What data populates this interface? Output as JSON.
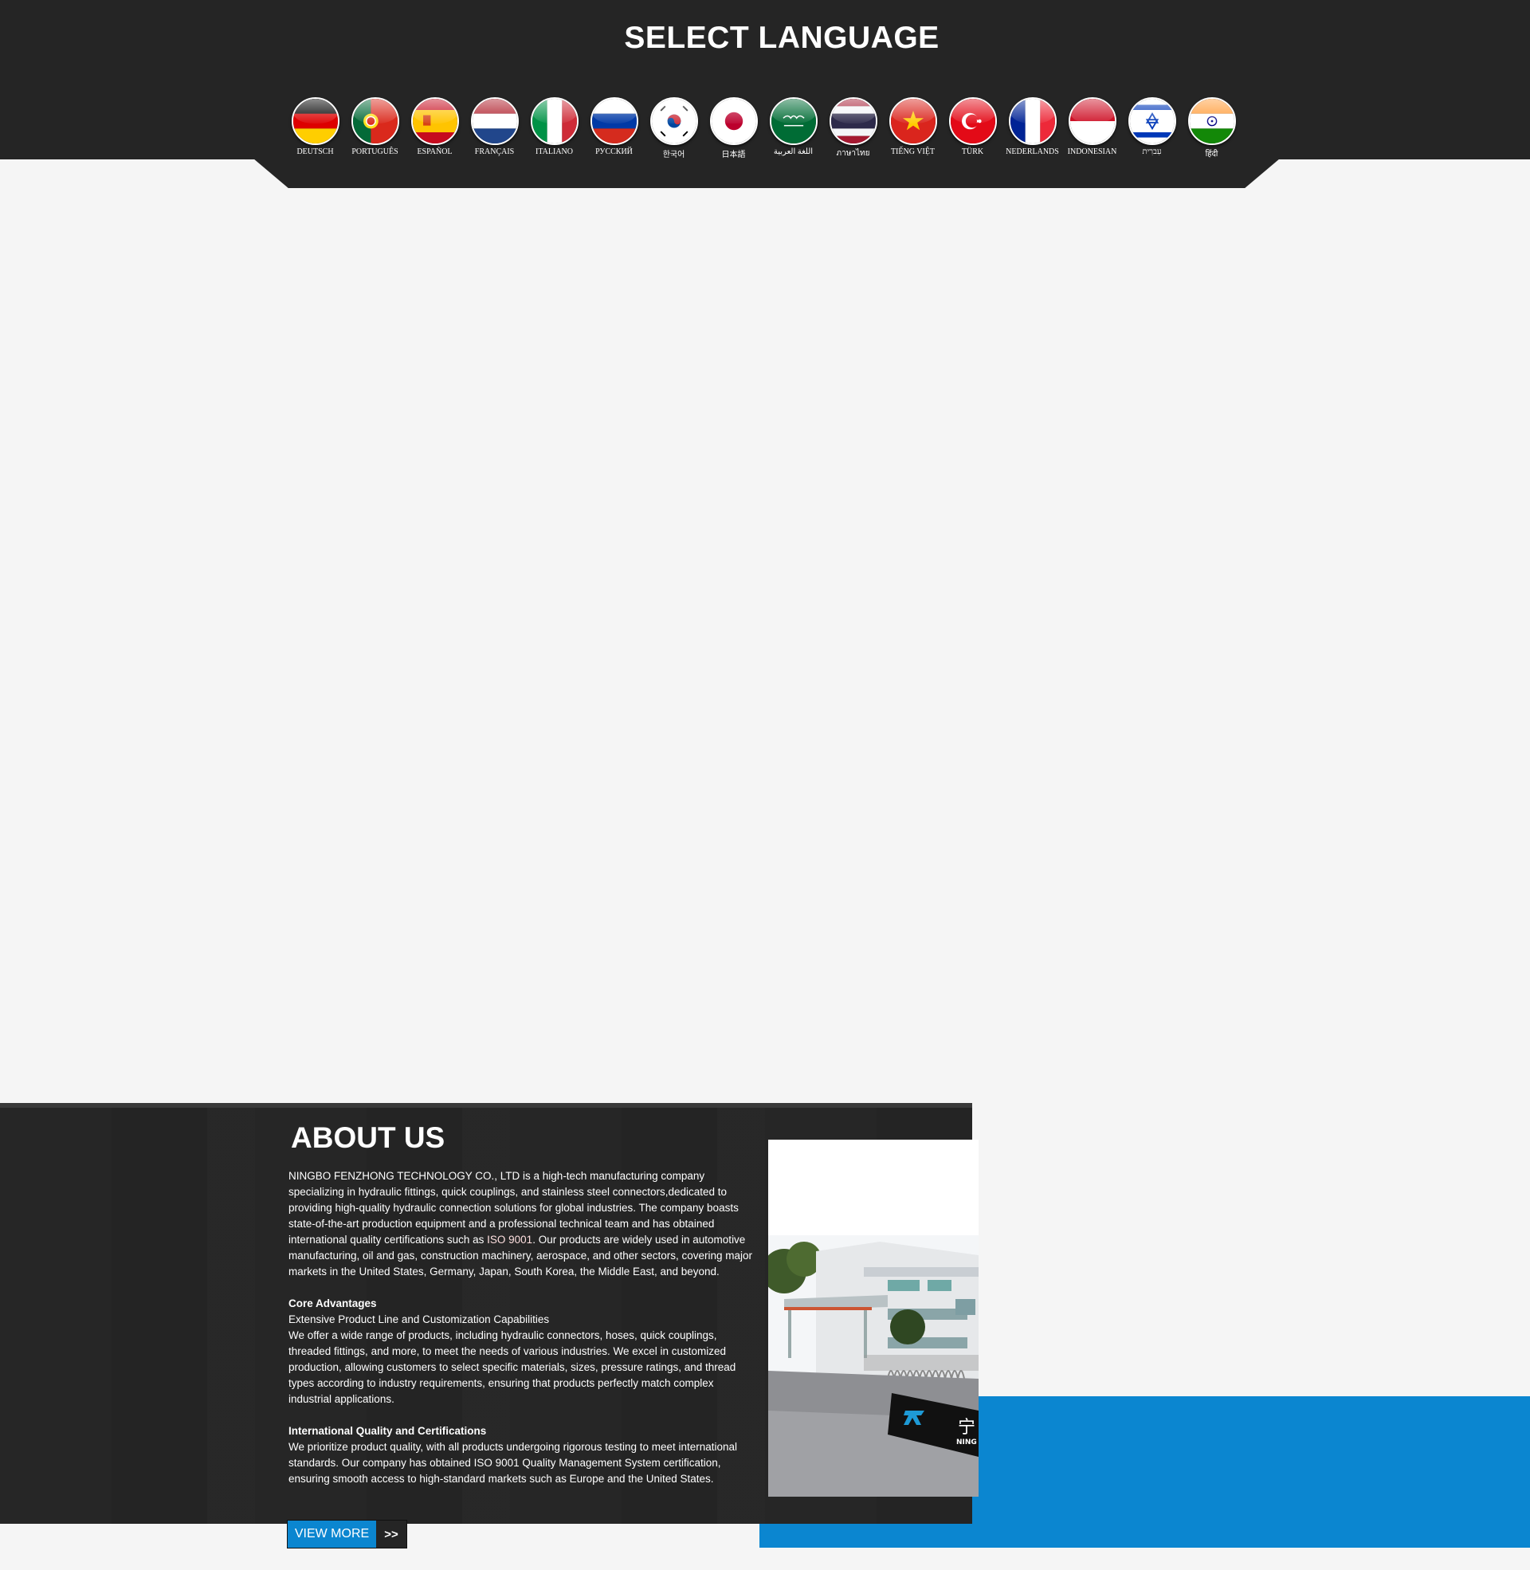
{
  "language_bar": {
    "title": "SELECT LANGUAGE",
    "languages": [
      {
        "label": "DEUTSCH",
        "flag": "germany-flag-icon"
      },
      {
        "label": "PORTUGUÊS",
        "flag": "portugal-flag-icon"
      },
      {
        "label": "ESPAÑOL",
        "flag": "spain-flag-icon"
      },
      {
        "label": "FRANÇAIS",
        "flag": "netherlands-flag-icon"
      },
      {
        "label": "ITALIANO",
        "flag": "italy-flag-icon"
      },
      {
        "label": "РУССКИЙ",
        "flag": "russia-flag-icon"
      },
      {
        "label": "한국어",
        "flag": "korea-flag-icon"
      },
      {
        "label": "日本語",
        "flag": "japan-flag-icon"
      },
      {
        "label": "اللغة العربية",
        "flag": "saudi-arabia-flag-icon"
      },
      {
        "label": "ภาษาไทย",
        "flag": "thailand-flag-icon"
      },
      {
        "label": "TIẾNG VIỆT",
        "flag": "vietnam-flag-icon"
      },
      {
        "label": "TÜRK",
        "flag": "turkey-flag-icon"
      },
      {
        "label": "NEDERLANDS",
        "flag": "france-flag-icon"
      },
      {
        "label": "INDONESIAN",
        "flag": "indonesia-flag-icon"
      },
      {
        "label": "עִברִית",
        "flag": "israel-flag-icon"
      },
      {
        "label": "हिंदी",
        "flag": "india-flag-icon"
      }
    ]
  },
  "about": {
    "title": "ABOUT US",
    "intro_before_iso": "NINGBO FENZHONG TECHNOLOGY CO., LTD is a high-tech manufacturing company specializing in hydraulic fittings, quick couplings, and stainless steel connectors,dedicated to providing high-quality hydraulic connection solutions for global industries. The company boasts state-of-the-art production equipment and a professional technical team and has obtained international quality certifications such as ",
    "intro_iso": "ISO 9001",
    "intro_after_iso": ". Our products are widely used in automotive manufacturing, oil and gas, construction machinery, aerospace, and other sectors, covering major markets in the United States, Germany, Japan, South Korea, the Middle East, and beyond.",
    "core_heading": "Core Advantages",
    "core_subheading": "Extensive Product Line and Customization Capabilities",
    "core_text": "We offer a wide range of products, including hydraulic connectors, hoses, quick couplings, threaded fittings, and more, to meet the needs of various industries. We excel in customized production, allowing customers to select specific materials, sizes, pressure ratings, and thread types according to industry requirements, ensuring that products perfectly match complex industrial applications.",
    "quality_heading": "International Quality and Certifications",
    "quality_text": "We prioritize product quality, with all products undergoing rigorous testing to meet international standards. Our company has obtained ISO 9001 Quality Management System certification, ensuring smooth access to high-standard markets such as Europe and the United States.",
    "sign_text": "宁",
    "sign_subtext": "NING",
    "view_more_label": "VIEW MORE",
    "view_more_arrow": ">>"
  },
  "colors": {
    "dark": "#252525",
    "accent_blue": "#0b86d0",
    "background": "#f5f5f5"
  }
}
